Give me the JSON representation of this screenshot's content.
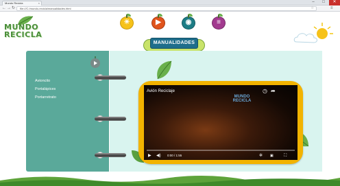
{
  "browser": {
    "tab_title": "Mundo Recicla",
    "tab_close": "×",
    "min": "–",
    "max": "□",
    "close": "✕",
    "url": "file:///C:/mundo-recicla/manualidades.html"
  },
  "logo": {
    "line1": "MUNDO",
    "line2": "RECICLA"
  },
  "nav": [
    {
      "name": "nav-lightbulb",
      "glyph": "☀",
      "color": "#f6c21a"
    },
    {
      "name": "nav-video",
      "glyph": "▶",
      "color": "#e0541c"
    },
    {
      "name": "nav-games",
      "glyph": "◉",
      "color": "#1d7d86"
    },
    {
      "name": "nav-list",
      "glyph": "≡",
      "color": "#a23a8f"
    }
  ],
  "banner": {
    "text": "MANUALIDADES"
  },
  "menu": {
    "items": [
      {
        "label": "Avioncito"
      },
      {
        "label": "Portalápices"
      },
      {
        "label": "Portarretrato"
      }
    ]
  },
  "video": {
    "title": "Avión Reciclaje",
    "logo_line1": "MUNDO",
    "logo_line2": "RECICLA",
    "time": "0:00 / 1:55",
    "play": "▶",
    "volume": "◀)",
    "settings": "✲",
    "fullscreen": "⛶"
  },
  "colors": {
    "notebook_left": "#5aa99a",
    "notebook_right": "#d9f4ef",
    "video_frame": "#f2b300"
  }
}
